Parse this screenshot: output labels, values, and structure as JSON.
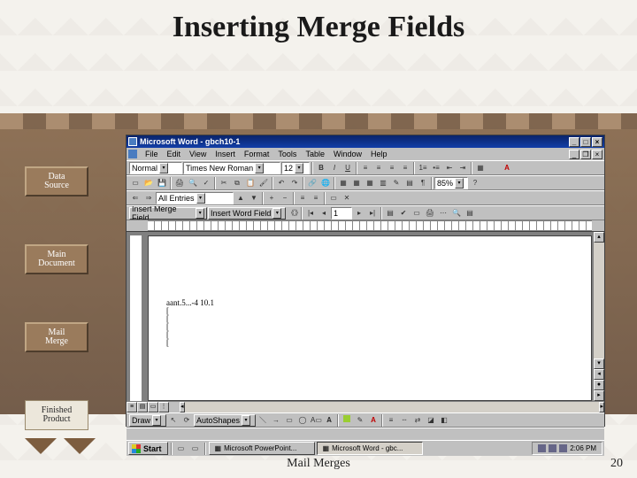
{
  "slide": {
    "title": "Inserting Merge Fields",
    "footer": "Mail Merges",
    "page_number": "20"
  },
  "nav": {
    "data_source": "Data\nSource",
    "main_document": "Main\nDocument",
    "mail_merge": "Mail\nMerge",
    "finished_product": "Finished\nProduct"
  },
  "word": {
    "title": "Microsoft Word - gbch10-1",
    "menu": [
      "File",
      "Edit",
      "View",
      "Insert",
      "Format",
      "Tools",
      "Table",
      "Window",
      "Help"
    ],
    "style_combo": "Normal",
    "font_combo": "Times New Roman",
    "size_combo": "12",
    "outline_combo": "All Entries",
    "merge_field_btn": "Insert Merge Field",
    "word_field_btn": "Insert Word Field",
    "zoom": "85%",
    "doc_lines": [
      "aant.5...-4 10.1",
      "[",
      "[",
      "[",
      "[",
      "["
    ],
    "draw_label": "Draw",
    "autoshapes_label": "AutoShapes",
    "taskbar": {
      "start": "Start",
      "powerpoint": "Microsoft PowerPoint...",
      "word": "Microsoft Word - gbc...",
      "clock": "2:06 PM"
    },
    "font_color": "#c00000",
    "highlight_color": "#ffff00",
    "fill_color": "#9acd32",
    "line_color": "#000000"
  }
}
